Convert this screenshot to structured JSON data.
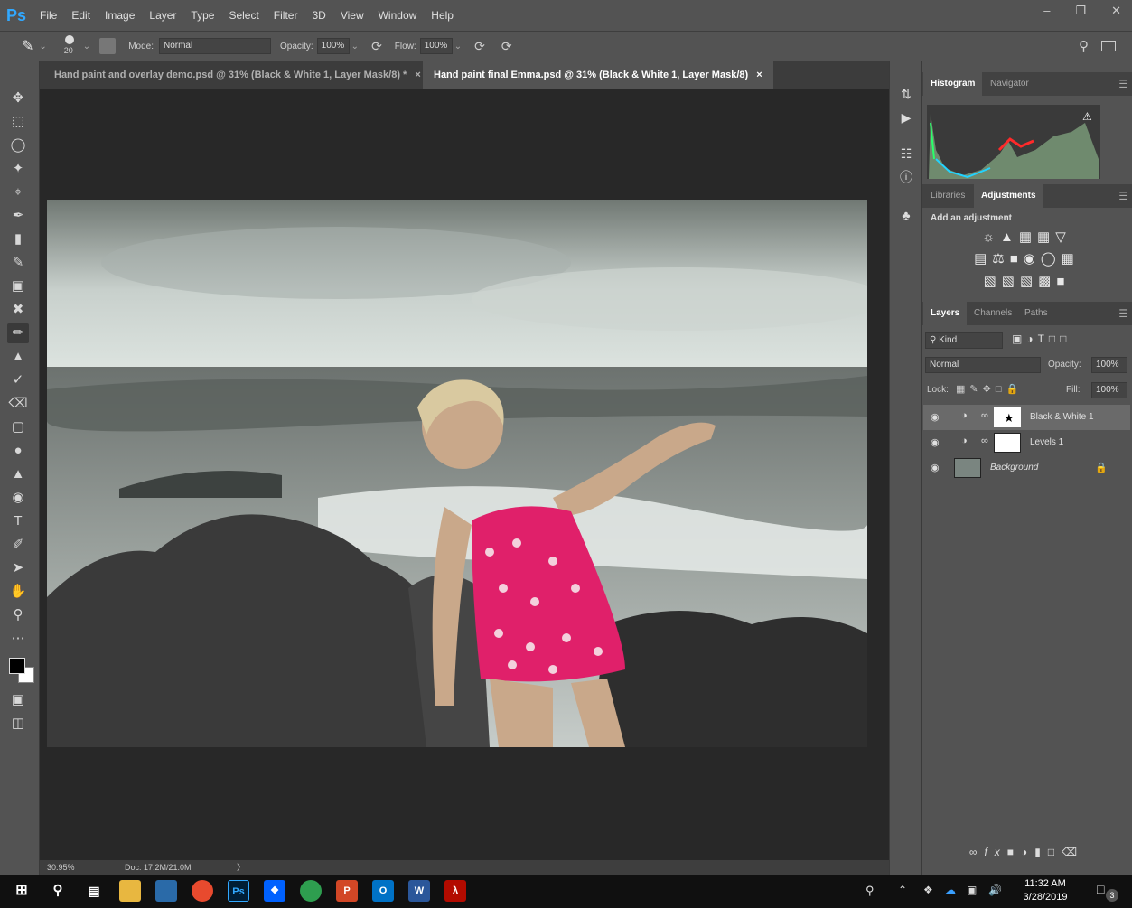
{
  "menu": {
    "logo": "Ps",
    "items": [
      "File",
      "Edit",
      "Image",
      "Layer",
      "Type",
      "Select",
      "Filter",
      "3D",
      "View",
      "Window",
      "Help"
    ]
  },
  "options": {
    "brush_size": "20",
    "mode_label": "Mode:",
    "mode_value": "Normal",
    "opacity_label": "Opacity:",
    "opacity_value": "100%",
    "flow_label": "Flow:",
    "flow_value": "100%"
  },
  "tabs": [
    {
      "title": "Hand paint and overlay demo.psd @ 31% (Black & White 1, Layer Mask/8) *",
      "close": "×"
    },
    {
      "title": "Hand paint final Emma.psd @ 31% (Black & White 1, Layer Mask/8)",
      "close": "×"
    }
  ],
  "status": {
    "zoom": "30.95%",
    "doc": "Doc: 17.2M/21.0M",
    "arrow": "〉"
  },
  "panels": {
    "histogram_tab": "Histogram",
    "navigator_tab": "Navigator",
    "libraries_tab": "Libraries",
    "adjustments_tab": "Adjustments",
    "add_adjustment": "Add an adjustment",
    "layers_tab": "Layers",
    "channels_tab": "Channels",
    "paths_tab": "Paths",
    "kind_filter": "Kind",
    "blend_mode": "Normal",
    "opacity_label": "Opacity:",
    "opacity_value": "100%",
    "lock_label": "Lock:",
    "fill_label": "Fill:",
    "fill_value": "100%"
  },
  "layers": [
    {
      "name": "Black & White 1",
      "selected": true
    },
    {
      "name": "Levels 1",
      "selected": false
    },
    {
      "name": "Background",
      "selected": false
    }
  ],
  "taskbar": {
    "time": "11:32 AM",
    "date": "3/28/2019",
    "notifications": "3",
    "app_labels": {
      "ps": "Ps",
      "ppt": "P",
      "outlook": "O",
      "word": "W"
    }
  },
  "colors": {
    "accent": "#31a8ff",
    "swimsuit": "#e0206a"
  }
}
